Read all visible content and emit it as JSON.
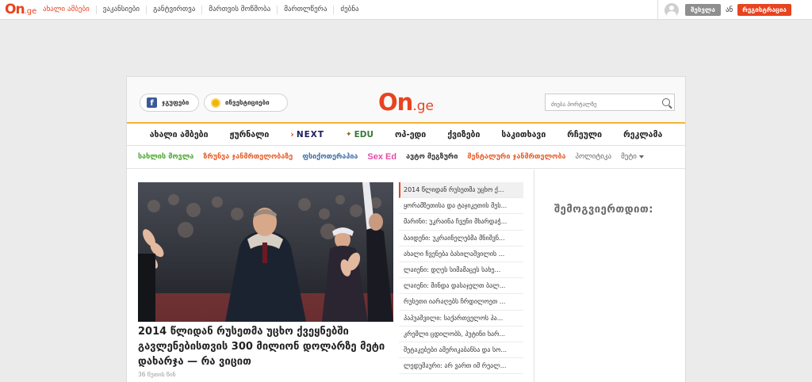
{
  "topbar": {
    "logo": {
      "on": "On",
      "ge": ".ge"
    },
    "nav": [
      "ახალი ამბები",
      "ვაკანსიები",
      "განტვირთვა",
      "მართვის მოწმობა",
      "მართლწერა",
      "ძებნა"
    ],
    "login_label": "შესვლა",
    "or_label": "ან",
    "register_label": "რეგისტრაცია"
  },
  "header": {
    "facebook_label": "ჯგუფები",
    "investors_label": "ინვესტიციები",
    "logo": {
      "on": "On",
      "ge": ".ge"
    },
    "search_placeholder": "ძიება პორტალზე"
  },
  "main_nav": {
    "items": [
      "ახალი ამბები",
      "ჟურნალი"
    ],
    "next_label": "NEXT",
    "edu_label": "EDU",
    "items_after": [
      "ოპ-ედი",
      "ქვიზები",
      "საკითხავი",
      "რჩეული",
      "რეკლამა"
    ]
  },
  "sub_nav": {
    "items": [
      "სახლის მოვლა",
      "ზრუნვა ჯანმრთელობაზე",
      "ფსიქოთერაპია",
      "Sex Ed",
      "ავტო მეგზური",
      "მენტალური ჯანმრთელობა",
      "პოლიტიკა",
      "მეტი"
    ]
  },
  "featured": {
    "headline": "2014 წლიდან რუსეთმა უცხო ქვეყნებში გავლენებისთვის 300 მილიონ დოლარზე მეტი დახარჯა — რა ვიცით",
    "time": "36 წუთის წინ"
  },
  "news_list": [
    "2014 წლიდან რუსეთმა უცხო ქ...",
    "ყორამზეთისა და ტაჯიკეთის მეს...",
    "მარინი: უკრაინა ჩვენი მხარდაჭ...",
    "ბაიდენი: უკრაინელებმა მნიშვნ...",
    "ახალი ჩვენება ბასილაშვილის ...",
    "ლაიენი: დღეს სიმამაცეს სახე...",
    "ლაიენი: მინდა დასაჯელთ ბალ...",
    "რუსეთი იარაღებს ჩრდილოეთ ...",
    "პაპუაშვილი: საქართველოს პა...",
    "კრემლი ცდილობს, პუტინი ხარ...",
    "შეტაკებები ამერიკაბანსა და სო...",
    "ლედუშაური: არ ვართ იმ რეალ..."
  ],
  "sidebar": {
    "follow_title": "შემოგვიერთდით:"
  }
}
